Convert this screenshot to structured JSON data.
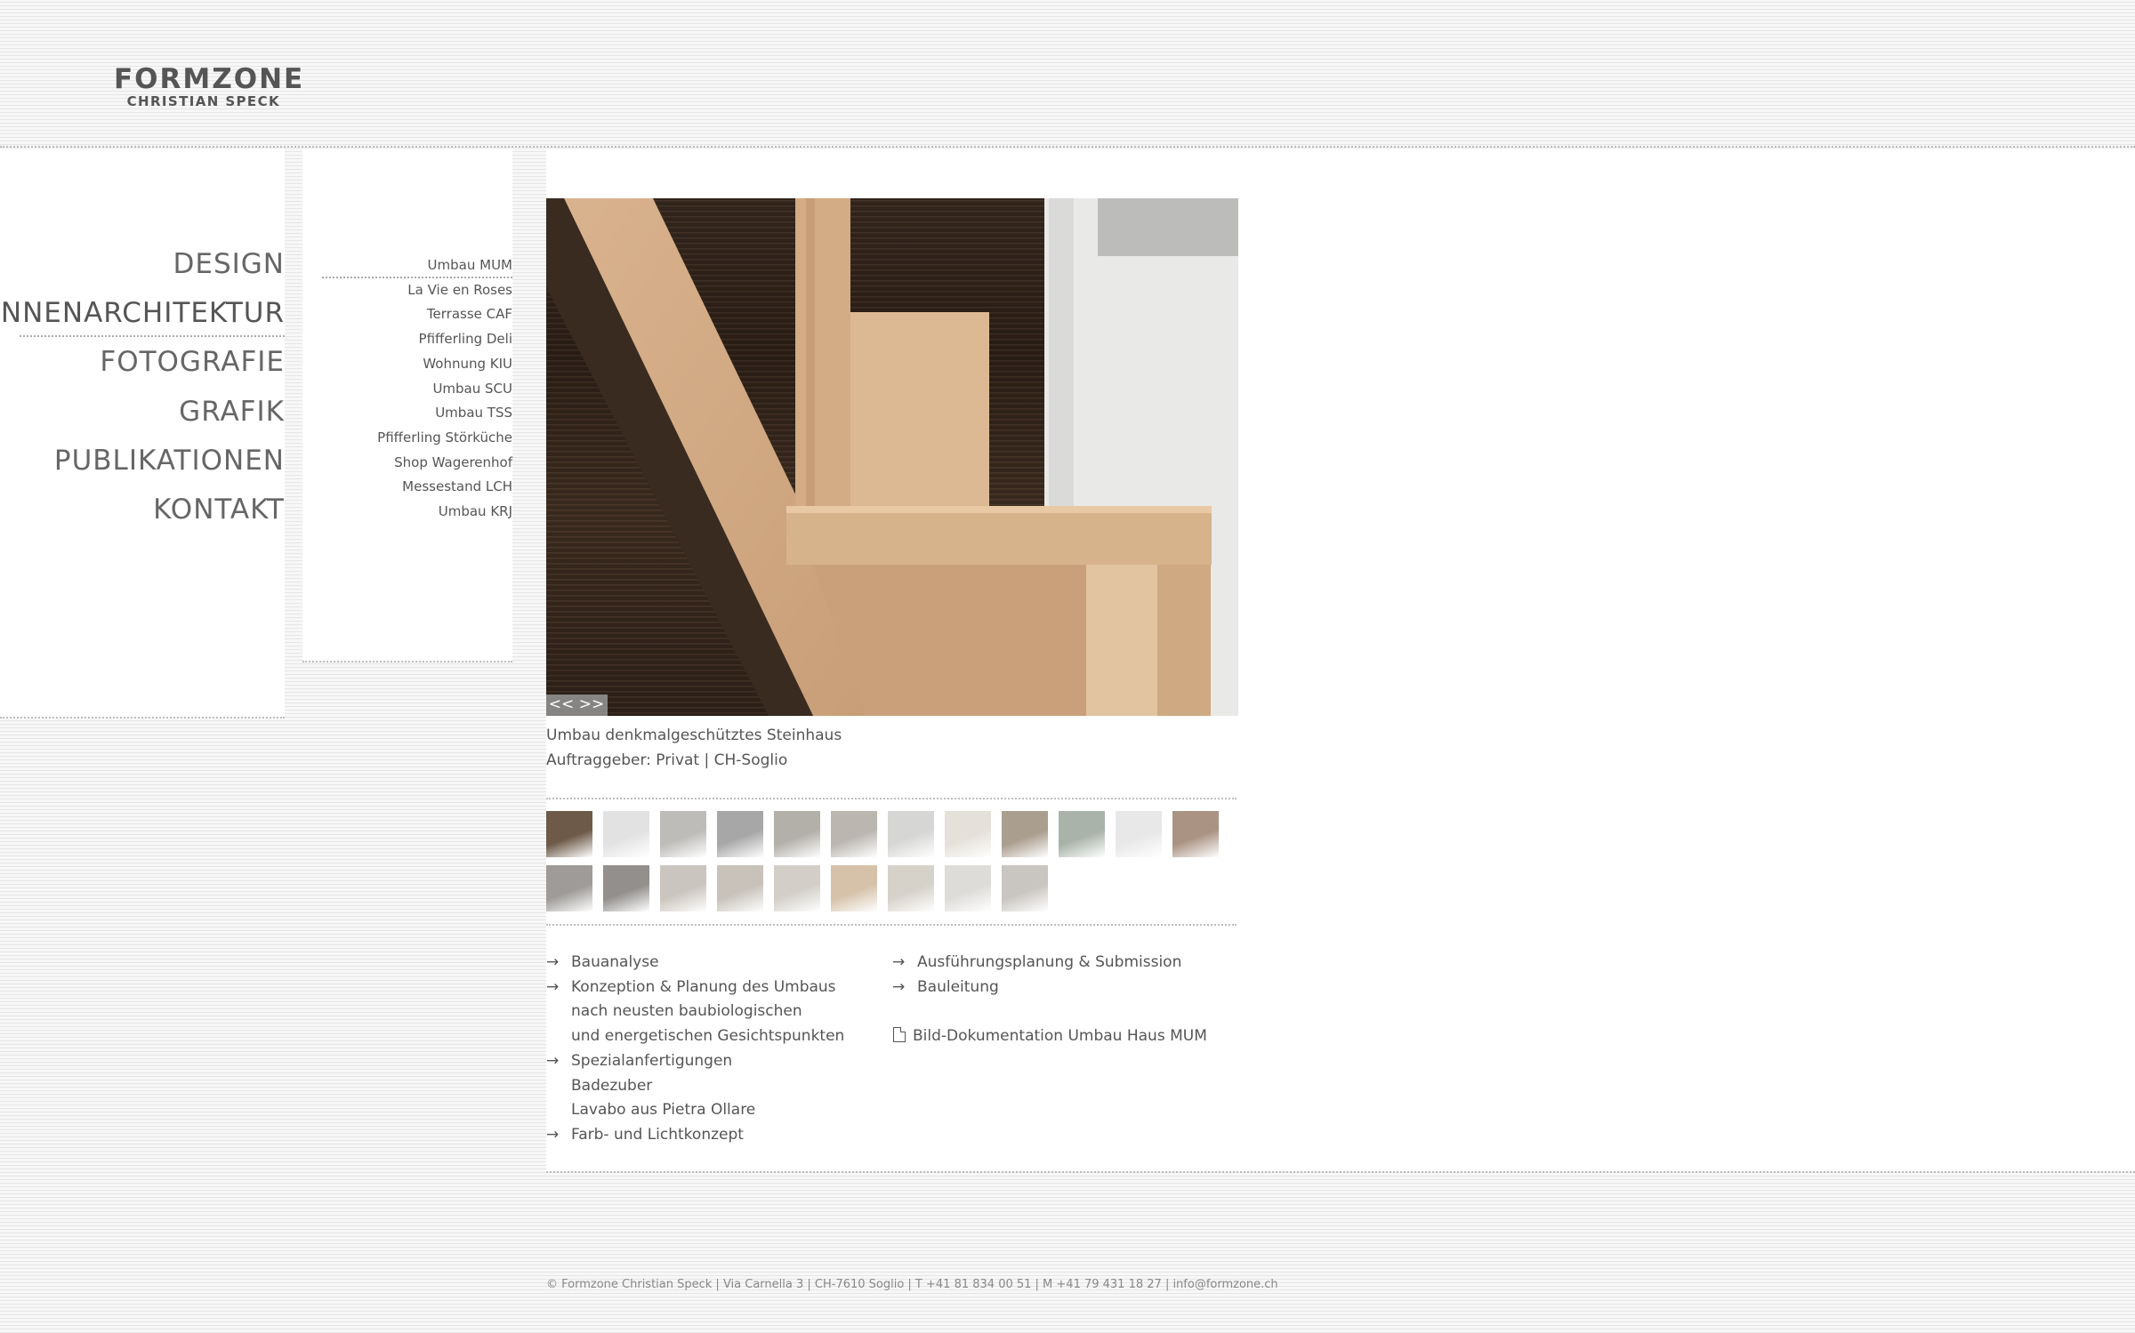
{
  "logo": {
    "line1": "FORMZONE",
    "line2": "CHRISTIAN SPECK"
  },
  "main_nav": [
    {
      "label": "DESIGN",
      "active": false
    },
    {
      "label": "INNENARCHITEKTUR",
      "active": true
    },
    {
      "label": "FOTOGRAFIE",
      "active": false
    },
    {
      "label": "GRAFIK",
      "active": false
    },
    {
      "label": "PUBLIKATIONEN",
      "active": false
    },
    {
      "label": "KONTAKT",
      "active": false
    }
  ],
  "sub_nav": [
    {
      "label": "Umbau MUM",
      "active": true
    },
    {
      "label": "La Vie en Roses"
    },
    {
      "label": "Terrasse CAF"
    },
    {
      "label": "Pfifferling Deli"
    },
    {
      "label": "Wohnung KIU"
    },
    {
      "label": "Umbau SCU"
    },
    {
      "label": "Umbau TSS"
    },
    {
      "label": "Pfifferling Störküche"
    },
    {
      "label": "Shop Wagerenhof"
    },
    {
      "label": "Messestand LCH"
    },
    {
      "label": "Umbau KRJ"
    }
  ],
  "slideshow": {
    "prev": "<<",
    "next": ">>"
  },
  "caption": {
    "title": "Umbau denkmalgeschütztes Steinhaus",
    "client": "Auftraggeber: Privat | CH-Soglio"
  },
  "thumbnails": {
    "row1_colors": [
      "#6d5a48",
      "#d8d8d8",
      "#a8a6a2",
      "#8a8a8a",
      "#9a958e",
      "#a49e96",
      "#c9c9c7",
      "#dcd6cc",
      "#8e7d68",
      "#8c9a8c",
      "#e0e0e0",
      "#8f6f5a"
    ],
    "row2_colors": [
      "#7e7a76",
      "#6e6a66",
      "#b9b2a8",
      "#b5aea3",
      "#c4bfb6",
      "#c7ad8c",
      "#c9c3b9",
      "#d2d0cc",
      "#b7b2ab"
    ]
  },
  "services_left": [
    {
      "arrow": "→",
      "text": "Bauanalyse"
    },
    {
      "arrow": "→",
      "text": "Konzeption & Planung des Umbaus"
    },
    {
      "arrow": "",
      "text": "nach neusten baubiologischen"
    },
    {
      "arrow": "",
      "text": "und energetischen Gesichtspunkten"
    },
    {
      "arrow": "→",
      "text": "Spezialanfertigungen"
    },
    {
      "arrow": "",
      "text": "Badezuber"
    },
    {
      "arrow": "",
      "text": "Lavabo aus Pietra Ollare"
    },
    {
      "arrow": "→",
      "text": "Farb- und Lichtkonzept"
    }
  ],
  "services_right": [
    {
      "arrow": "→",
      "text": "Ausführungsplanung & Submission"
    },
    {
      "arrow": "→",
      "text": "Bauleitung"
    }
  ],
  "pdf_link": {
    "icon": "pdf-document-icon",
    "label": "Bild-Dokumentation Umbau Haus MUM"
  },
  "footer": "© Formzone Christian Speck | Via Carnella 3 | CH-7610 Soglio | T +41 81 834 00 51 | M +41 79 431 18 27 | info@formzone.ch"
}
